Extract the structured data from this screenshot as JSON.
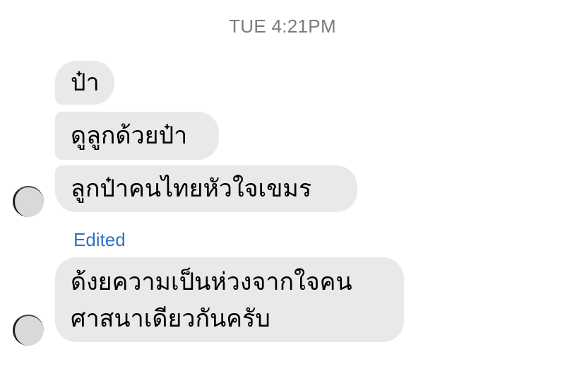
{
  "timestamp": "TUE 4:21PM",
  "messages": [
    {
      "lines": [
        "ป๋า"
      ]
    },
    {
      "lines": [
        "ดูลูกด้วยป๋า"
      ]
    },
    {
      "lines": [
        "ลูกป๋าคนไทยหัวใจเขมร"
      ]
    },
    {
      "lines": [
        "ด้งยความเป็นห่วงจากใจคน",
        "ศาสนาเดียวกันครับ"
      ]
    }
  ],
  "edited_label": "Edited",
  "colors": {
    "bubble": "#e9e9eb",
    "timestamp": "#7b7b80",
    "edited": "#2c74c4"
  }
}
